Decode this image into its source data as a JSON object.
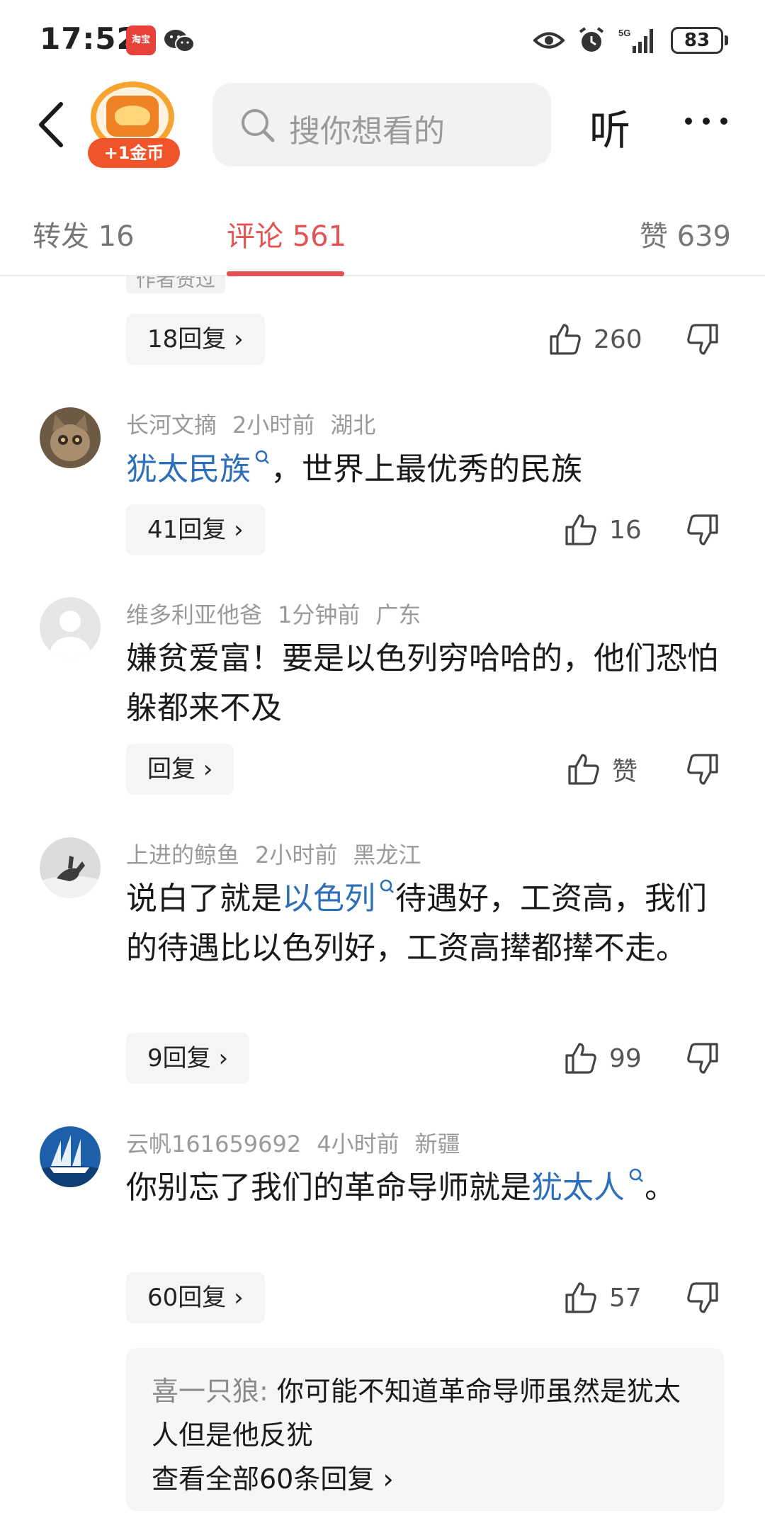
{
  "status_bar": {
    "time": "17:52",
    "app_badge_text": "淘宝",
    "battery": "83",
    "network": "5G"
  },
  "header": {
    "coin_label": "+1金币",
    "search_placeholder": "搜你想看的",
    "listen_label": "听"
  },
  "tabs": [
    {
      "label": "转发 16"
    },
    {
      "label": "评论 561",
      "active": true
    },
    {
      "label": "赞 639"
    }
  ],
  "first_comment_tail": {
    "author_liked_badge": "作者赞过",
    "reply_label": "18回复",
    "likes": "260"
  },
  "comments": [
    {
      "user": "长河文摘",
      "time": "2小时前",
      "location": "湖北",
      "text_link": "犹太民族",
      "text_rest": "，世界上最优秀的民族",
      "reply_label": "41回复",
      "likes": "16"
    },
    {
      "user": "维多利亚他爸",
      "time": "1分钟前",
      "location": "广东",
      "text": "嫌贫爱富！要是以色列穷哈哈的，他们恐怕躲都来不及",
      "reply_label": "回复",
      "likes": "赞"
    },
    {
      "user": "上进的鲸鱼",
      "time": "2小时前",
      "location": "黑龙江",
      "text_before": "说白了就是",
      "text_link": "以色列",
      "text_after": "待遇好，工资高，我们的待遇比以色列好，工资高撵都撵不走。",
      "reply_label": "9回复",
      "likes": "99"
    },
    {
      "user": "云帆161659692",
      "time": "4小时前",
      "location": "新疆",
      "text_before": "你别忘了我们的革命导师就是",
      "text_link": "犹太人",
      "text_after": "。",
      "reply_label": "60回复",
      "likes": "57",
      "sub_reply": {
        "author": "喜一只狼: ",
        "text": "你可能不知道革命导师虽然是犹太人但是他反犹",
        "view_all": "查看全部60条回复"
      }
    }
  ],
  "colors": {
    "accent_red": "#e45353",
    "link_blue": "#2d6fb8",
    "coin_orange": "#f08226"
  }
}
